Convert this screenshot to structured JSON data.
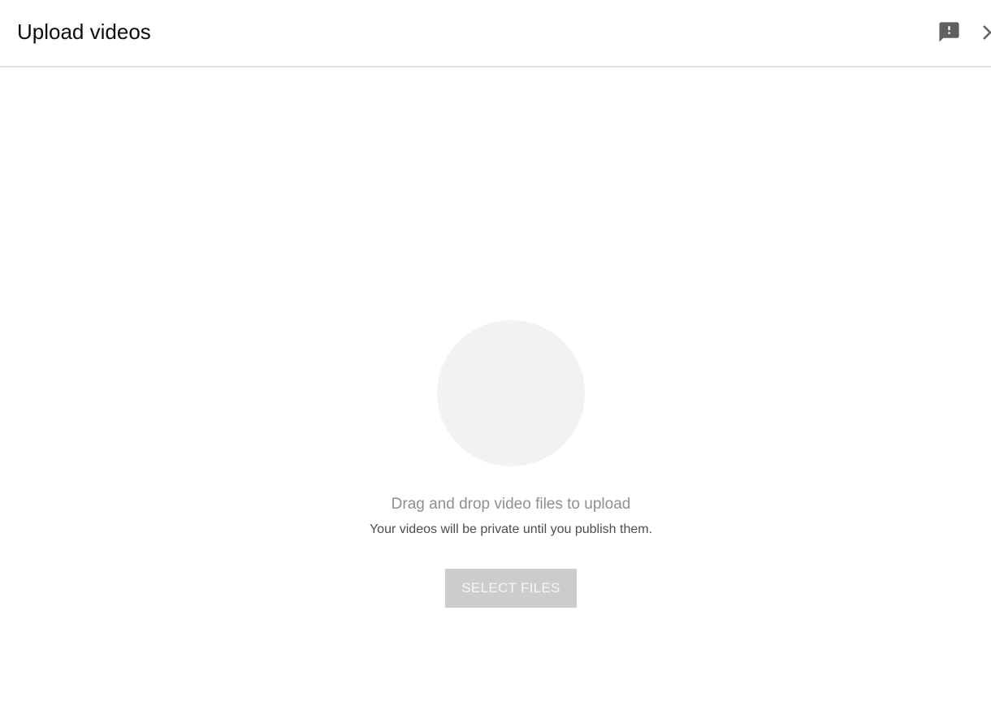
{
  "dialog": {
    "title": "Upload videos",
    "header_icons": [
      "feedback-icon",
      "close-icon"
    ]
  },
  "dropzone": {
    "icon": "upload-circle",
    "primary_text": "Drag and drop video files to upload",
    "secondary_text": "Your videos will be private until you publish them."
  },
  "actions": {
    "select_files_label": "SELECT FILES"
  },
  "colors": {
    "title": "#0d0d0d",
    "header_border": "#e0e0e0",
    "icon": "#606060",
    "circle": "#f2f2f2",
    "primary_text": "#8f8f8f",
    "secondary_text": "#4d4d4d",
    "button_bg": "#cccccc",
    "button_text": "#f6f6f6"
  }
}
